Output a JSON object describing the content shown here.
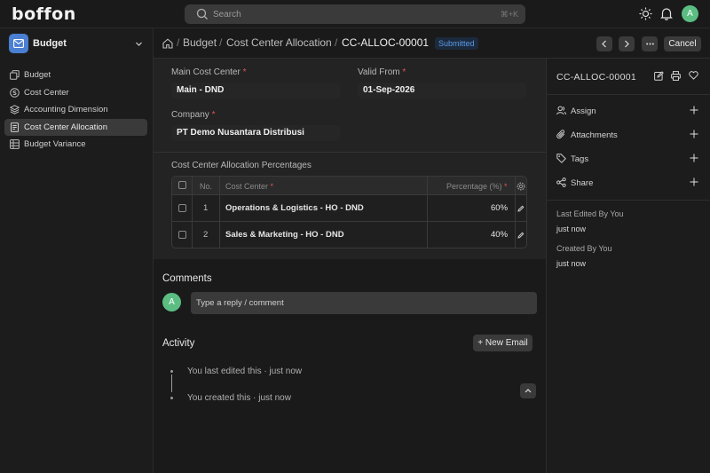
{
  "app": {
    "logo": "boffon"
  },
  "search": {
    "placeholder": "Search",
    "shortcut": "⌘+K"
  },
  "user": {
    "initial": "A"
  },
  "colors": {
    "accent_blue": "#4a7fd1",
    "avatar_green": "#5bbd82",
    "required_red": "#e05555",
    "badge_blue": "#5a9ae6"
  },
  "sidebar": {
    "workspace": {
      "label": "Budget",
      "icon": "envelope-icon"
    },
    "items": [
      {
        "label": "Budget",
        "icon": "copy-icon",
        "active": false
      },
      {
        "label": "Cost Center",
        "icon": "coin-icon",
        "active": false
      },
      {
        "label": "Accounting Dimension",
        "icon": "stack-icon",
        "active": false
      },
      {
        "label": "Cost Center Allocation",
        "icon": "doc-icon",
        "active": true
      },
      {
        "label": "Budget Variance",
        "icon": "table-icon",
        "active": false
      }
    ]
  },
  "breadcrumb": {
    "items": [
      "Budget",
      "Cost Center Allocation"
    ],
    "doc": "CC-ALLOC-00001",
    "status": "Submitted",
    "cancel_label": "Cancel"
  },
  "form": {
    "main_cost_center": {
      "label": "Main Cost Center",
      "value": "Main - DND"
    },
    "valid_from": {
      "label": "Valid From",
      "value": "01-Sep-2026"
    },
    "company": {
      "label": "Company",
      "value": "PT Demo Nusantara Distribusi"
    },
    "required_mark": "*"
  },
  "table": {
    "title": "Cost Center Allocation Percentages",
    "headers": {
      "no": "No.",
      "cost_center": "Cost Center",
      "percentage": "Percentage (%)"
    },
    "rows": [
      {
        "no": "1",
        "cost_center": "Operations & Logistics - HO - DND",
        "percentage": "60%"
      },
      {
        "no": "2",
        "cost_center": "Sales & Marketing - HO - DND",
        "percentage": "40%"
      }
    ]
  },
  "comments": {
    "title": "Comments",
    "placeholder": "Type a reply / comment"
  },
  "activity": {
    "title": "Activity",
    "new_email": "+ New Email",
    "entries": [
      "You last edited this · just now",
      "You created this · just now"
    ]
  },
  "right_panel": {
    "doc_name": "CC-ALLOC-00001",
    "actions": [
      "Assign",
      "Attachments",
      "Tags",
      "Share"
    ],
    "last_edited_label": "Last Edited By You",
    "last_edited_value": "just now",
    "created_label": "Created By You",
    "created_value": "just now"
  }
}
